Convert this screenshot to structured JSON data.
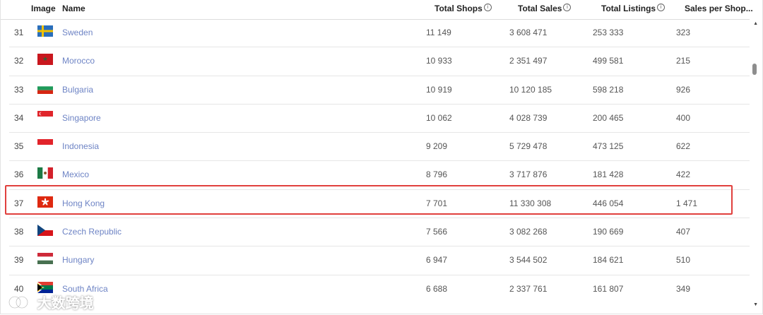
{
  "columns": {
    "image": "Image",
    "name": "Name",
    "total_shops": "Total Shops",
    "total_sales": "Total Sales",
    "total_listings": "Total Listings",
    "sales_per_shop": "Sales per Shop..."
  },
  "rows": [
    {
      "rank": "31",
      "name": "Sweden",
      "flag": "sweden-flag-icon",
      "shops": "11 149",
      "sales": "3 608 471",
      "listings": "253 333",
      "per_shop": "323"
    },
    {
      "rank": "32",
      "name": "Morocco",
      "flag": "morocco-flag-icon",
      "shops": "10 933",
      "sales": "2 351 497",
      "listings": "499 581",
      "per_shop": "215"
    },
    {
      "rank": "33",
      "name": "Bulgaria",
      "flag": "bulgaria-flag-icon",
      "shops": "10 919",
      "sales": "10 120 185",
      "listings": "598 218",
      "per_shop": "926"
    },
    {
      "rank": "34",
      "name": "Singapore",
      "flag": "singapore-flag-icon",
      "shops": "10 062",
      "sales": "4 028 739",
      "listings": "200 465",
      "per_shop": "400"
    },
    {
      "rank": "35",
      "name": "Indonesia",
      "flag": "indonesia-flag-icon",
      "shops": "9 209",
      "sales": "5 729 478",
      "listings": "473 125",
      "per_shop": "622"
    },
    {
      "rank": "36",
      "name": "Mexico",
      "flag": "mexico-flag-icon",
      "shops": "8 796",
      "sales": "3 717 876",
      "listings": "181 428",
      "per_shop": "422"
    },
    {
      "rank": "37",
      "name": "Hong Kong",
      "flag": "hong-kong-flag-icon",
      "shops": "7 701",
      "sales": "11 330 308",
      "listings": "446 054",
      "per_shop": "1 471"
    },
    {
      "rank": "38",
      "name": "Czech Republic",
      "flag": "czech-flag-icon",
      "shops": "7 566",
      "sales": "3 082 268",
      "listings": "190 669",
      "per_shop": "407"
    },
    {
      "rank": "39",
      "name": "Hungary",
      "flag": "hungary-flag-icon",
      "shops": "6 947",
      "sales": "3 544 502",
      "listings": "184 621",
      "per_shop": "510"
    },
    {
      "rank": "40",
      "name": "South Africa",
      "flag": "south-africa-flag-icon",
      "shops": "6 688",
      "sales": "2 337 761",
      "listings": "161 807",
      "per_shop": "349"
    }
  ],
  "highlight_row": "37",
  "colors": {
    "link": "#6e84c5",
    "highlight": "#e0403d"
  },
  "watermark": {
    "text": "大数跨境"
  }
}
